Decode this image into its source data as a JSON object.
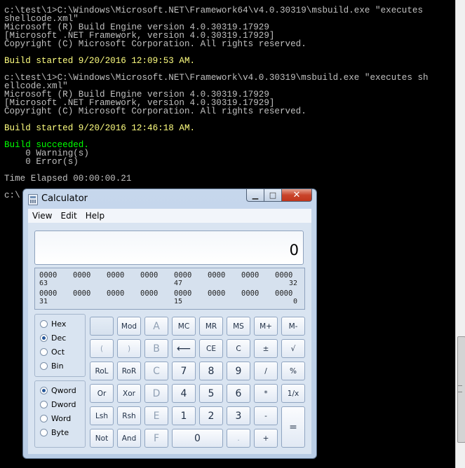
{
  "console": {
    "lines": [
      {
        "text": "c:\\test\\1>C:\\Windows\\Microsoft.NET\\Framework64\\v4.0.30319\\msbuild.exe \"executes",
        "color": ""
      },
      {
        "text": "shellcode.xml\"",
        "color": ""
      },
      {
        "text": "Microsoft (R) Build Engine version 4.0.30319.17929",
        "color": ""
      },
      {
        "text": "[Microsoft .NET Framework, version 4.0.30319.17929]",
        "color": ""
      },
      {
        "text": "Copyright (C) Microsoft Corporation. All rights reserved.",
        "color": ""
      },
      {
        "text": "",
        "color": ""
      },
      {
        "text": "Build started 9/20/2016 12:09:53 AM.",
        "color": "yellow"
      },
      {
        "text": "",
        "color": ""
      },
      {
        "text": "c:\\test\\1>C:\\Windows\\Microsoft.NET\\Framework\\v4.0.30319\\msbuild.exe \"executes sh",
        "color": ""
      },
      {
        "text": "ellcode.xml\"",
        "color": ""
      },
      {
        "text": "Microsoft (R) Build Engine version 4.0.30319.17929",
        "color": ""
      },
      {
        "text": "[Microsoft .NET Framework, version 4.0.30319.17929]",
        "color": ""
      },
      {
        "text": "Copyright (C) Microsoft Corporation. All rights reserved.",
        "color": ""
      },
      {
        "text": "",
        "color": ""
      },
      {
        "text": "Build started 9/20/2016 12:46:18 AM.",
        "color": "yellow"
      },
      {
        "text": "",
        "color": ""
      },
      {
        "text": "Build succeeded.",
        "color": "green"
      },
      {
        "text": "    0 Warning(s)",
        "color": ""
      },
      {
        "text": "    0 Error(s)",
        "color": ""
      },
      {
        "text": "",
        "color": ""
      },
      {
        "text": "Time Elapsed 00:00:00.21",
        "color": ""
      },
      {
        "text": "",
        "color": ""
      },
      {
        "text": "c:\\",
        "color": ""
      }
    ]
  },
  "calculator": {
    "title": "Calculator",
    "controls": {
      "minimize": "▁",
      "maximize": "□",
      "close": "✕"
    },
    "menu": [
      "View",
      "Edit",
      "Help"
    ],
    "display_value": "0",
    "bits_row1": [
      "0000",
      "0000",
      "0000",
      "0000",
      "0000",
      "0000",
      "0000",
      "0000"
    ],
    "bits_row1_labels": {
      "left": "63",
      "mid": "47",
      "right": "32"
    },
    "bits_row2": [
      "0000",
      "0000",
      "0000",
      "0000",
      "0000",
      "0000",
      "0000",
      "0000"
    ],
    "bits_row2_labels": {
      "left": "31",
      "mid": "15",
      "right": "0"
    },
    "base_options": [
      {
        "label": "Hex",
        "selected": false
      },
      {
        "label": "Dec",
        "selected": true
      },
      {
        "label": "Oct",
        "selected": false
      },
      {
        "label": "Bin",
        "selected": false
      }
    ],
    "word_options": [
      {
        "label": "Qword",
        "selected": true
      },
      {
        "label": "Dword",
        "selected": false
      },
      {
        "label": "Word",
        "selected": false
      },
      {
        "label": "Byte",
        "selected": false
      }
    ],
    "buttons": [
      {
        "label": "",
        "name": "blank-button"
      },
      {
        "label": "Mod",
        "name": "mod-button"
      },
      {
        "label": "A",
        "name": "hex-a-button"
      },
      {
        "label": "MC",
        "name": "memory-clear-button"
      },
      {
        "label": "MR",
        "name": "memory-recall-button"
      },
      {
        "label": "MS",
        "name": "memory-store-button"
      },
      {
        "label": "M+",
        "name": "memory-add-button"
      },
      {
        "label": "M-",
        "name": "memory-subtract-button"
      },
      {
        "label": "(",
        "name": "open-paren-button"
      },
      {
        "label": ")",
        "name": "close-paren-button"
      },
      {
        "label": "B",
        "name": "hex-b-button"
      },
      {
        "label": "⟵",
        "name": "backspace-button"
      },
      {
        "label": "CE",
        "name": "clear-entry-button"
      },
      {
        "label": "C",
        "name": "clear-button"
      },
      {
        "label": "±",
        "name": "negate-button"
      },
      {
        "label": "√",
        "name": "sqrt-button"
      },
      {
        "label": "RoL",
        "name": "rotate-left-button"
      },
      {
        "label": "RoR",
        "name": "rotate-right-button"
      },
      {
        "label": "C",
        "name": "hex-c-button"
      },
      {
        "label": "7",
        "name": "digit-7-button"
      },
      {
        "label": "8",
        "name": "digit-8-button"
      },
      {
        "label": "9",
        "name": "digit-9-button"
      },
      {
        "label": "/",
        "name": "divide-button"
      },
      {
        "label": "%",
        "name": "percent-button"
      },
      {
        "label": "Or",
        "name": "or-button"
      },
      {
        "label": "Xor",
        "name": "xor-button"
      },
      {
        "label": "D",
        "name": "hex-d-button"
      },
      {
        "label": "4",
        "name": "digit-4-button"
      },
      {
        "label": "5",
        "name": "digit-5-button"
      },
      {
        "label": "6",
        "name": "digit-6-button"
      },
      {
        "label": "*",
        "name": "multiply-button"
      },
      {
        "label": "1/x",
        "name": "reciprocal-button"
      },
      {
        "label": "Lsh",
        "name": "left-shift-button"
      },
      {
        "label": "Rsh",
        "name": "right-shift-button"
      },
      {
        "label": "E",
        "name": "hex-e-button"
      },
      {
        "label": "1",
        "name": "digit-1-button"
      },
      {
        "label": "2",
        "name": "digit-2-button"
      },
      {
        "label": "3",
        "name": "digit-3-button"
      },
      {
        "label": "-",
        "name": "subtract-button"
      },
      {
        "label": "=",
        "name": "equals-button"
      },
      {
        "label": "Not",
        "name": "not-button"
      },
      {
        "label": "And",
        "name": "and-button"
      },
      {
        "label": "F",
        "name": "hex-f-button"
      },
      {
        "label": "0",
        "name": "digit-0-button"
      },
      {
        "label": ".",
        "name": "decimal-button"
      },
      {
        "label": "+",
        "name": "add-button"
      }
    ]
  },
  "colors": {
    "console_bg": "#000000",
    "console_text": "#c0c0c0",
    "green": "#00ff00",
    "yellow": "#ffff80"
  }
}
